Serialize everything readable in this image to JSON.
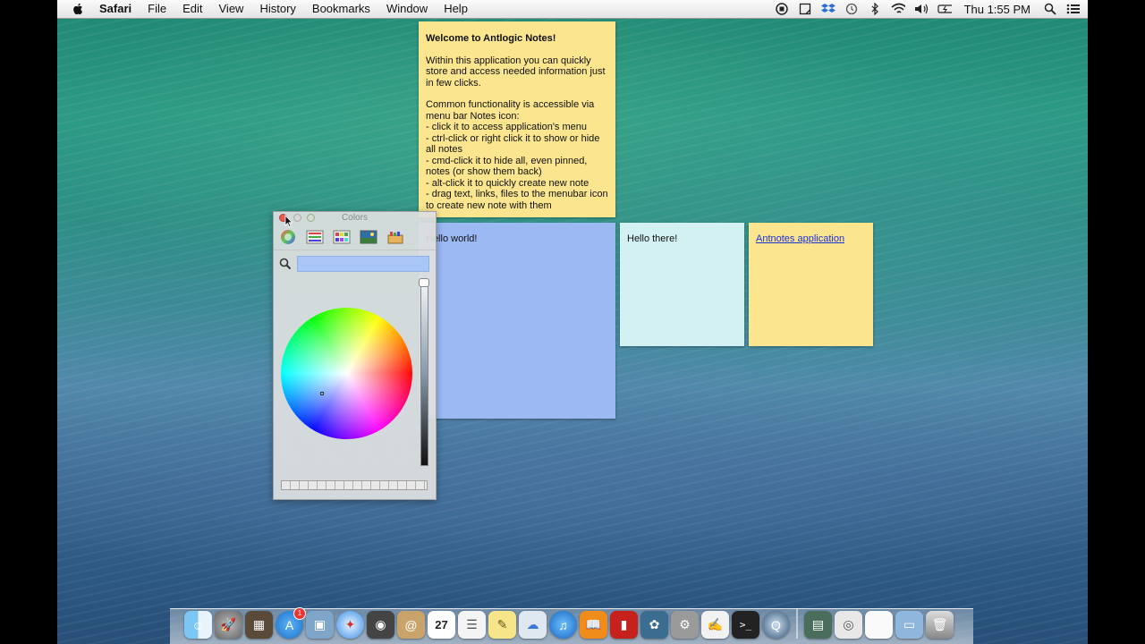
{
  "menubar": {
    "app": "Safari",
    "menus": [
      "File",
      "Edit",
      "View",
      "History",
      "Bookmarks",
      "Window",
      "Help"
    ],
    "clock": "Thu 1:55 PM",
    "status_icons": [
      "record-icon",
      "notes-icon",
      "dropbox-icon",
      "time-machine-icon",
      "bluetooth-icon",
      "wifi-icon",
      "volume-icon",
      "battery-icon"
    ]
  },
  "notes": {
    "welcome": {
      "title": "Welcome to Antlogic Notes!",
      "p1": "Within this application you can quickly store and access needed information just in few clicks.",
      "p2_intro": "Common functionality is accessible via menu bar Notes icon:",
      "lines": [
        "- click it to access application's menu",
        "- ctrl-click or right click it to show or hide all notes",
        "- cmd-click it to hide all, even pinned, notes (or show them back)",
        "- alt-click it to quickly create new note",
        "- drag text, links, files to the menubar icon to create new note with them"
      ]
    },
    "hello_world": "Hello world!",
    "hello_there": "Hello there!",
    "antnotes_link": "Antnotes application"
  },
  "colors_panel": {
    "title": "Colors",
    "modes": [
      "color-wheel-icon",
      "color-sliders-icon",
      "color-palettes-icon",
      "image-palettes-icon",
      "crayons-icon"
    ],
    "search_value": ""
  },
  "dock": {
    "icons": [
      "finder-icon",
      "launchpad-icon",
      "mission-control-icon",
      "app-store-icon",
      "preview-icon",
      "safari-icon",
      "facetime-icon",
      "contacts-icon",
      "calendar-icon",
      "reminders-icon",
      "notes-icon",
      "messages-icon",
      "itunes-icon",
      "ibooks-icon",
      "photo-booth-icon",
      "iphoto-icon",
      "system-preferences-icon",
      "textedit-icon",
      "terminal-icon",
      "quicktime-icon",
      "archive-utility-icon",
      "disk-image-icon",
      "document-icon",
      "folder-icon",
      "trash-icon"
    ],
    "calendar_day": "27",
    "app_store_badge": "1"
  },
  "colors": {
    "note_yellow": "#fbe58f",
    "note_blue": "#9db9f4",
    "note_cyan": "#d3f1f3",
    "link": "#1b31d4"
  }
}
